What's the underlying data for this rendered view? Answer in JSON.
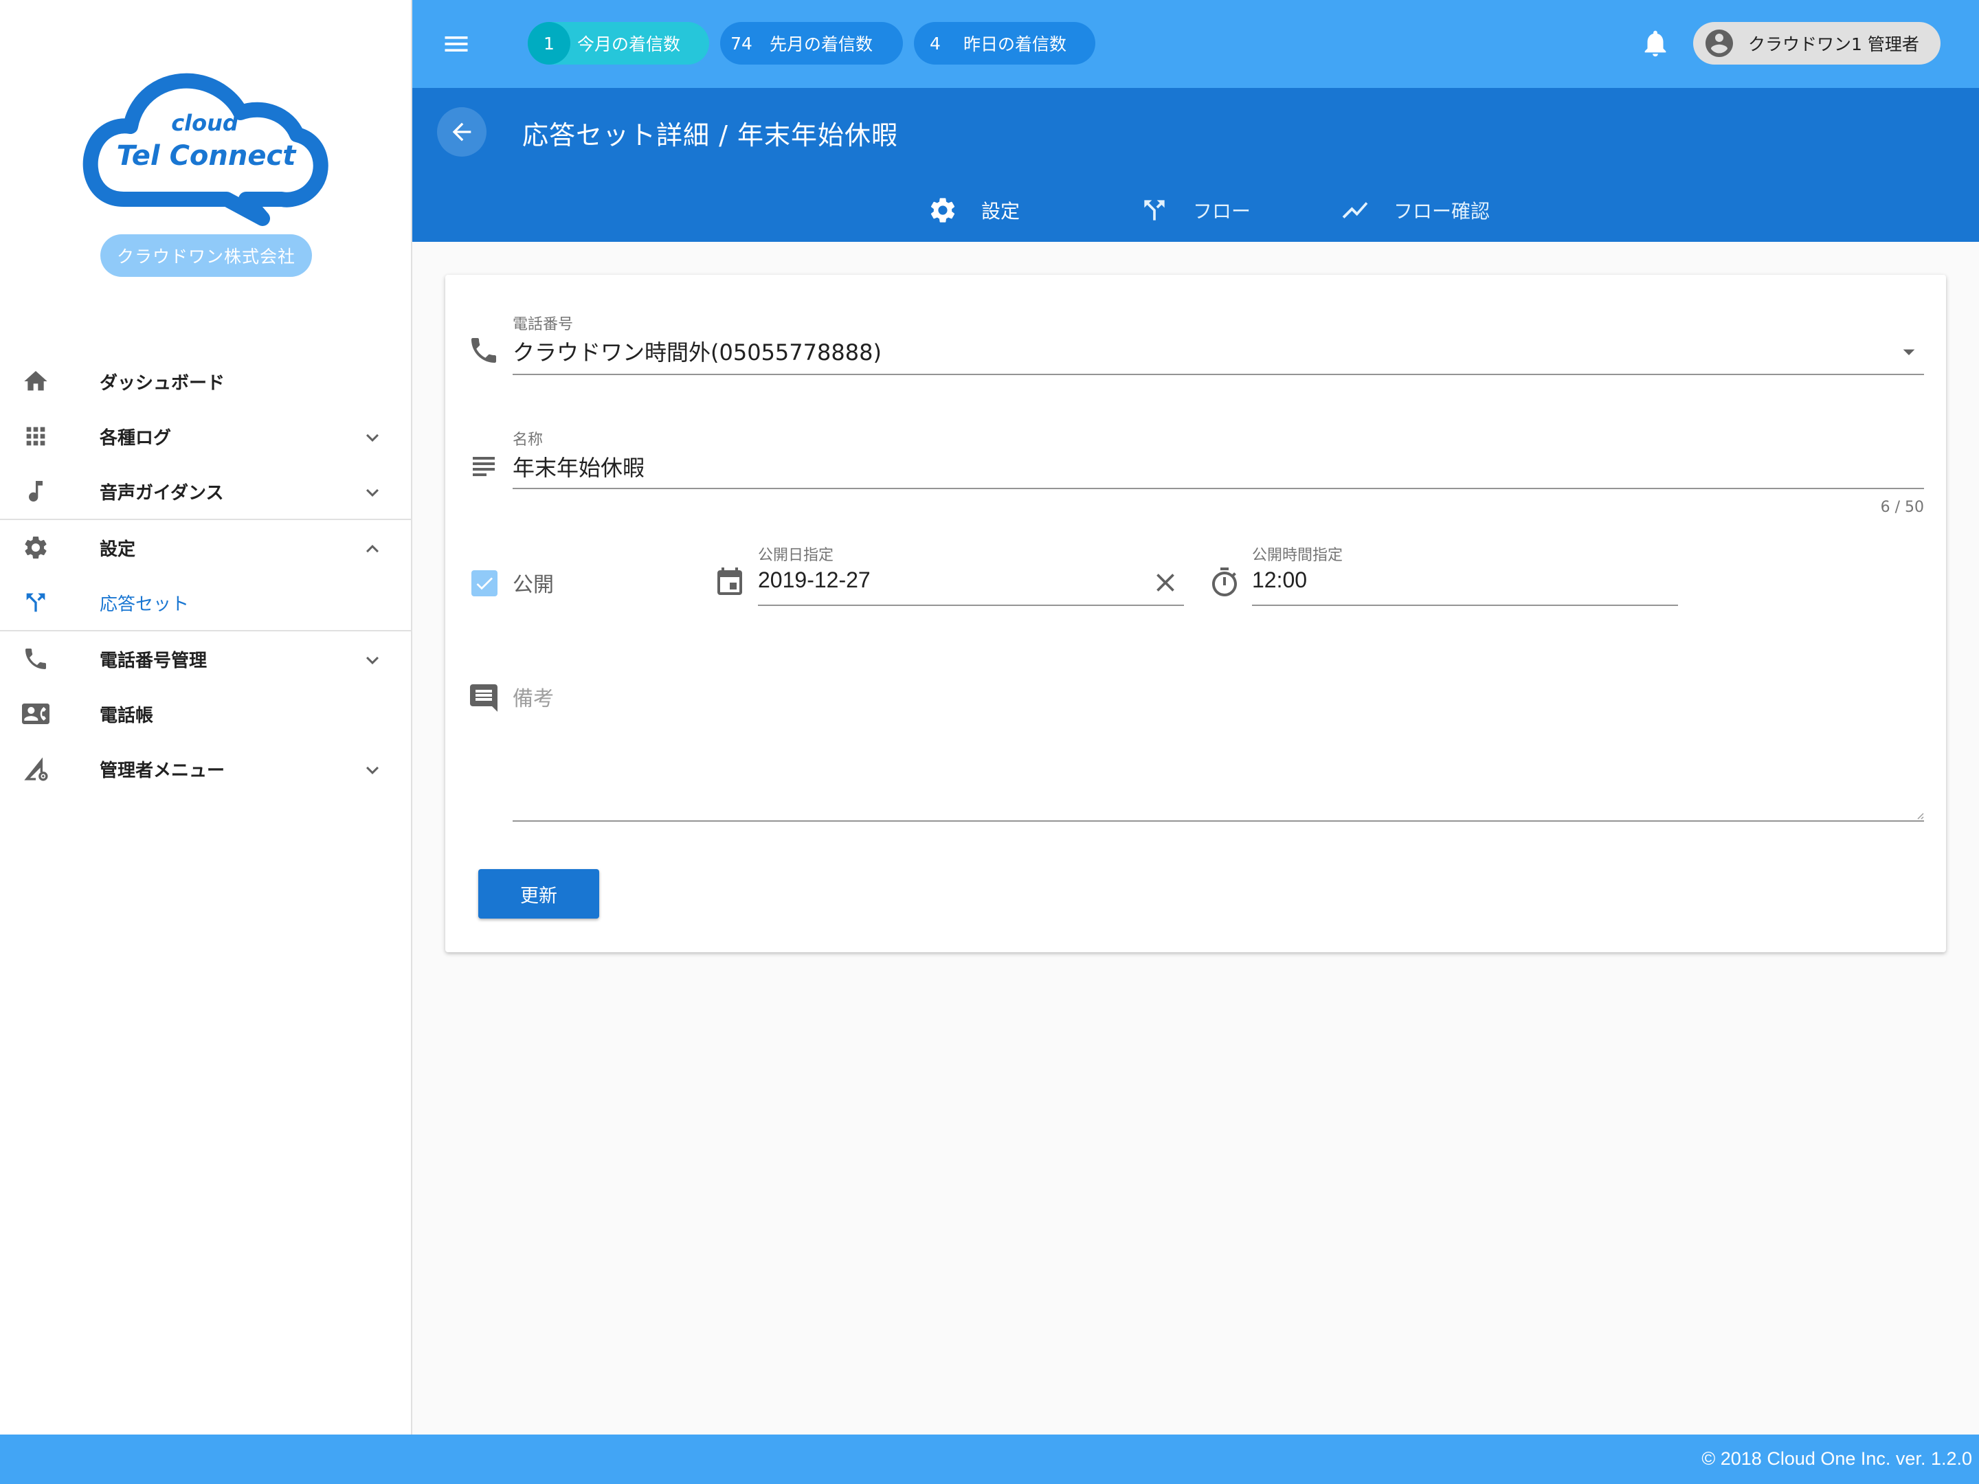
{
  "brand": {
    "logo_small": "cloud",
    "logo_large": "Tel Connect",
    "company": "クラウドワン株式会社",
    "logo_color": "#1976d2"
  },
  "sidebar": {
    "items": [
      {
        "label": "ダッシュボード",
        "icon": "home-icon"
      },
      {
        "label": "各種ログ",
        "icon": "apps-icon",
        "expand": "chevron-down"
      },
      {
        "label": "音声ガイダンス",
        "icon": "music-note-icon",
        "expand": "chevron-down"
      },
      {
        "label": "設定",
        "icon": "gear-icon",
        "expand": "chevron-up"
      },
      {
        "label": "応答セット",
        "icon": "call-split-icon",
        "active": true
      },
      {
        "label": "電話番号管理",
        "icon": "phone-icon",
        "expand": "chevron-down"
      },
      {
        "label": "電話帳",
        "icon": "contact-card-icon"
      },
      {
        "label": "管理者メニュー",
        "icon": "admin-signal-icon",
        "expand": "chevron-down"
      }
    ]
  },
  "topbar": {
    "stats": [
      {
        "count": "1",
        "label": "今月の着信数"
      },
      {
        "count": "74",
        "label": "先月の着信数"
      },
      {
        "count": "4",
        "label": "昨日の着信数"
      }
    ],
    "user": "クラウドワン1 管理者"
  },
  "header": {
    "title": "応答セット詳細 / 年末年始休暇",
    "tabs": [
      {
        "label": "設定",
        "icon": "gear-icon"
      },
      {
        "label": "フロー",
        "icon": "call-split-icon"
      },
      {
        "label": "フロー確認",
        "icon": "trending-icon"
      }
    ]
  },
  "form": {
    "phone": {
      "label": "電話番号",
      "value": "クラウドワン時間外(05055778888)"
    },
    "name": {
      "label": "名称",
      "value": "年末年始休暇",
      "counter": "6 / 50"
    },
    "publish": {
      "label": "公開",
      "checked": true
    },
    "publish_date": {
      "label": "公開日指定",
      "value": "2019-12-27"
    },
    "publish_time": {
      "label": "公開時間指定",
      "value": "12:00"
    },
    "notes": {
      "placeholder": "備考"
    },
    "submit_label": "更新"
  },
  "footer": {
    "copyright": "© 2018 Cloud One Inc. ver. 1.2.0"
  },
  "colors": {
    "primary": "#1976d2",
    "topbar": "#42a5f5",
    "badge": "#1e88e5",
    "badge_active": "#26c6da"
  }
}
